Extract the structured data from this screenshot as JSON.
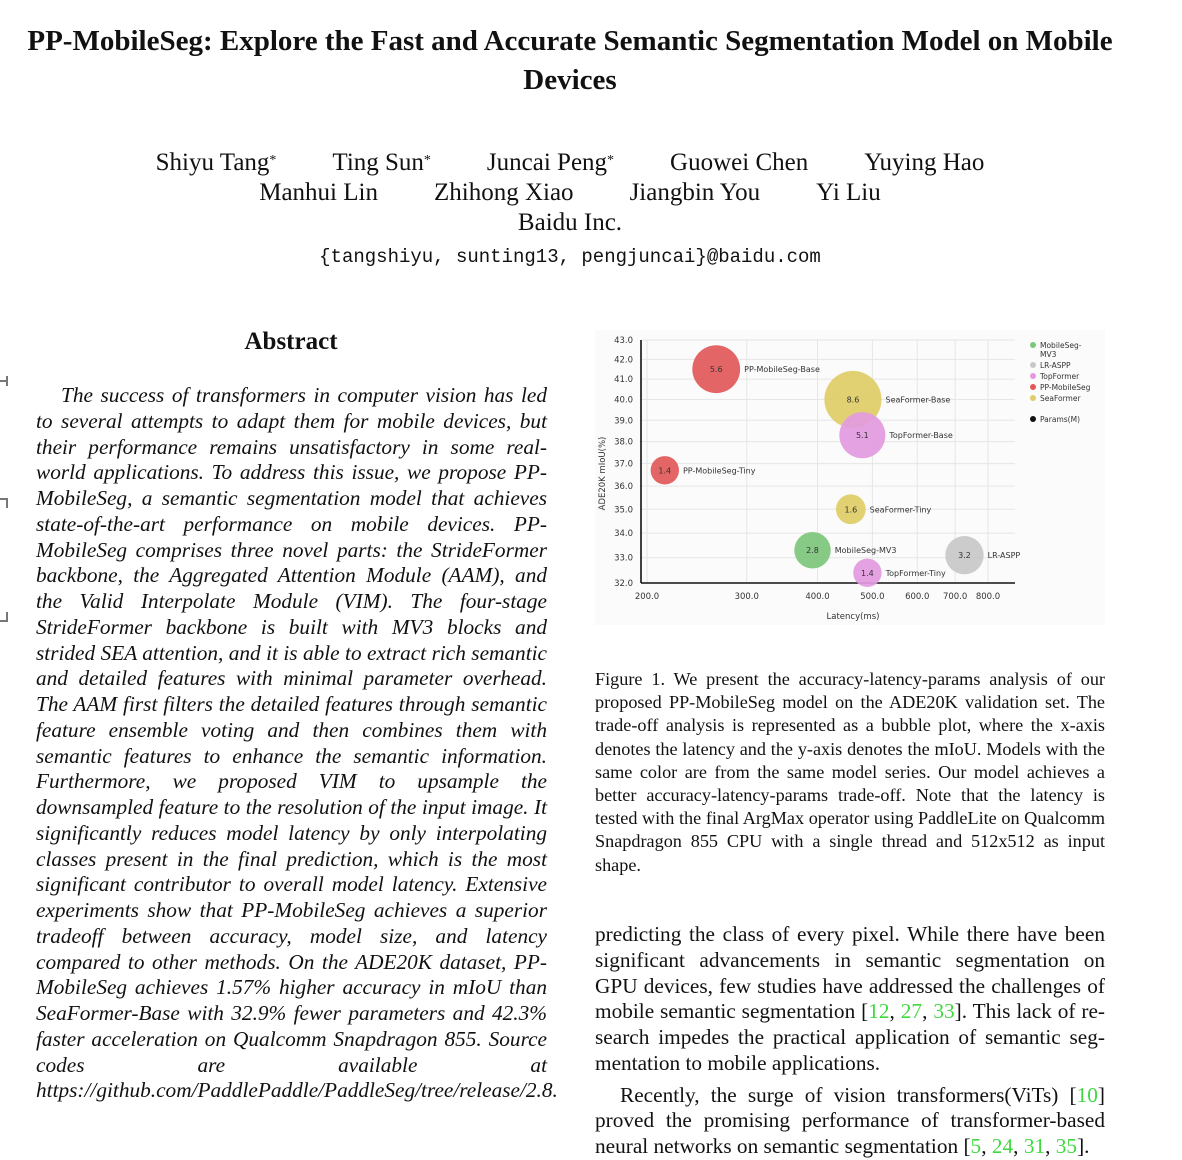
{
  "paper": {
    "title": "PP-MobileSeg: Explore the Fast and Accurate Semantic Segmentation Model on Mobile Devices",
    "authors_row1": [
      {
        "name": "Shiyu Tang",
        "mark": "*"
      },
      {
        "name": "Ting Sun",
        "mark": "*"
      },
      {
        "name": "Juncai Peng",
        "mark": "*"
      },
      {
        "name": "Guowei Chen",
        "mark": ""
      },
      {
        "name": "Yuying Hao",
        "mark": ""
      }
    ],
    "authors_row2": [
      {
        "name": "Manhui Lin",
        "mark": ""
      },
      {
        "name": "Zhihong Xiao",
        "mark": ""
      },
      {
        "name": "Jiangbin You",
        "mark": ""
      },
      {
        "name": "Yi Liu",
        "mark": ""
      }
    ],
    "affiliation": "Baidu Inc.",
    "email": "{tangshiyu, sunting13, pengjuncai}@baidu.com"
  },
  "abstract": {
    "heading": "Abstract",
    "text": "The success of transformers in computer vision has led to several attempts to adapt them for mobile de­vices, but their performance remains unsatisfactory in some real-world applications.  To address this issue, we propose PP-MobileSeg, a semantic segmentation model that achieves state-of-the-art performance on mobile devices.  PP-MobileSeg comprises three novel parts: the StrideFormer backbone, the Aggregated Attention Module (AAM), and the Valid Interpolate Module (VIM). The four-stage StrideFormer backbone is built with MV3 blocks and strided SEA attention, and it is able to ex­tract rich semantic and detailed features with minimal parameter overhead.  The AAM first filters the detailed features through semantic feature ensemble voting and then combines them with semantic features to enhance the semantic information.  Furthermore, we proposed VIM to upsample the downsampled feature to the resolution of the input image. It significantly reduces model latency by only interpolating classes present in the final prediction, which is the most significant contributor to overall model latency.  Extensive experiments show that PP-MobileSeg achieves a superior tradeoff between accuracy, model size, and latency compared to other methods.  On the ADE20K dataset, PP-MobileSeg achieves 1.57% higher accuracy in mIoU than SeaFormer-Base with 32.9% fewer parameters and 42.3% faster acceleration on Qual­comm Snapdragon 855.  Source codes are available at https://github.com/PaddlePaddle/PaddleSeg/tree/release/2.8."
  },
  "figure": {
    "caption": "Figure 1. We present the accuracy-latency-params analysis of our proposed PP-MobileSeg model on the ADE20K validation set. The trade-off analysis is represented as a bubble plot, where the x-axis denotes the latency and the y-axis denotes the mIoU. Mod­els with the same color are from the same model series.  Our model achieves a better accuracy-latency-params trade-off.  Note that the latency is tested with the final ArgMax operator using Pad­dleLite on Qualcomm Snapdragon 855 CPU with a single thread and 512x512 as input shape."
  },
  "chart_data": {
    "type": "scatter",
    "subtype": "bubble",
    "title": "",
    "xlabel": "Latency(ms)",
    "ylabel": "ADE20K mIoU(%)",
    "xscale": "log",
    "yscale": "log",
    "xlim": [
      195,
      880
    ],
    "ylim": [
      32.0,
      43.0
    ],
    "x_ticks": [
      "200.0",
      "300.0",
      "400.0",
      "500.0",
      "600.0",
      "700.0",
      "800.0"
    ],
    "x_tick_values": [
      200,
      300,
      400,
      500,
      600,
      700,
      800
    ],
    "y_ticks": [
      "32.0",
      "33.0",
      "34.0",
      "35.0",
      "36.0",
      "37.0",
      "38.0",
      "39.0",
      "40.0",
      "41.0",
      "42.0",
      "43.0"
    ],
    "y_tick_values": [
      32,
      33,
      34,
      35,
      36,
      37,
      38,
      39,
      40,
      41,
      42,
      43
    ],
    "grid": true,
    "legend_position": "right",
    "legend": [
      {
        "name": "MobileSeg-MV3",
        "color": "#7cc67c"
      },
      {
        "name": "LR-ASPP",
        "color": "#c8c8c8"
      },
      {
        "name": "TopFormer",
        "color": "#e39ae0"
      },
      {
        "name": "PP-MobileSeg",
        "color": "#e25858"
      },
      {
        "name": "SeaFormer",
        "color": "#e0cd67"
      }
    ],
    "size_legend": "Params(M)",
    "points": [
      {
        "name": "PP-MobileSeg-Base",
        "series": "PP-MobileSeg",
        "latency": 265,
        "miou": 41.5,
        "params": 5.6,
        "params_label": "5.6"
      },
      {
        "name": "PP-MobileSeg-Tiny",
        "series": "PP-MobileSeg",
        "latency": 215,
        "miou": 36.7,
        "params": 1.4,
        "params_label": "1.4"
      },
      {
        "name": "SeaFormer-Base",
        "series": "SeaFormer",
        "latency": 462,
        "miou": 40.0,
        "params": 8.6,
        "params_label": "8.6"
      },
      {
        "name": "TopFormer-Base",
        "series": "TopFormer",
        "latency": 480,
        "miou": 38.3,
        "params": 5.1,
        "params_label": "5.1"
      },
      {
        "name": "SeaFormer-Tiny",
        "series": "SeaFormer",
        "latency": 458,
        "miou": 35.0,
        "params": 1.6,
        "params_label": "1.6"
      },
      {
        "name": "MobileSeg-MV3",
        "series": "MobileSeg-MV3",
        "latency": 392,
        "miou": 33.3,
        "params": 2.8,
        "params_label": "2.8"
      },
      {
        "name": "TopFormer-Tiny",
        "series": "TopFormer",
        "latency": 490,
        "miou": 32.4,
        "params": 1.4,
        "params_label": "1.4"
      },
      {
        "name": "LR-ASPP",
        "series": "LR-ASPP",
        "latency": 727,
        "miou": 33.1,
        "params": 3.2,
        "params_label": "3.2"
      }
    ]
  },
  "body": {
    "p1_a": "predicting the class of every pixel.  While there have been significant advancements in semantic segmentation on GPU devices, few studies have addressed the challenges of mo­bile semantic segmentation [",
    "p1_cites": [
      "12",
      "27",
      "33"
    ],
    "p1_b": "].  This lack of re­search impedes the practical application of semantic seg­mentation to mobile applications.",
    "p2_a": "Recently, the surge of vision transformers(ViTs) [",
    "p2_cite1": "10",
    "p2_b": "] proved the promising performance of transformer-based neural networks on semantic segmentation [",
    "p2_cites": [
      "5",
      "24",
      "31",
      "35"
    ],
    "p2_c": "]."
  }
}
